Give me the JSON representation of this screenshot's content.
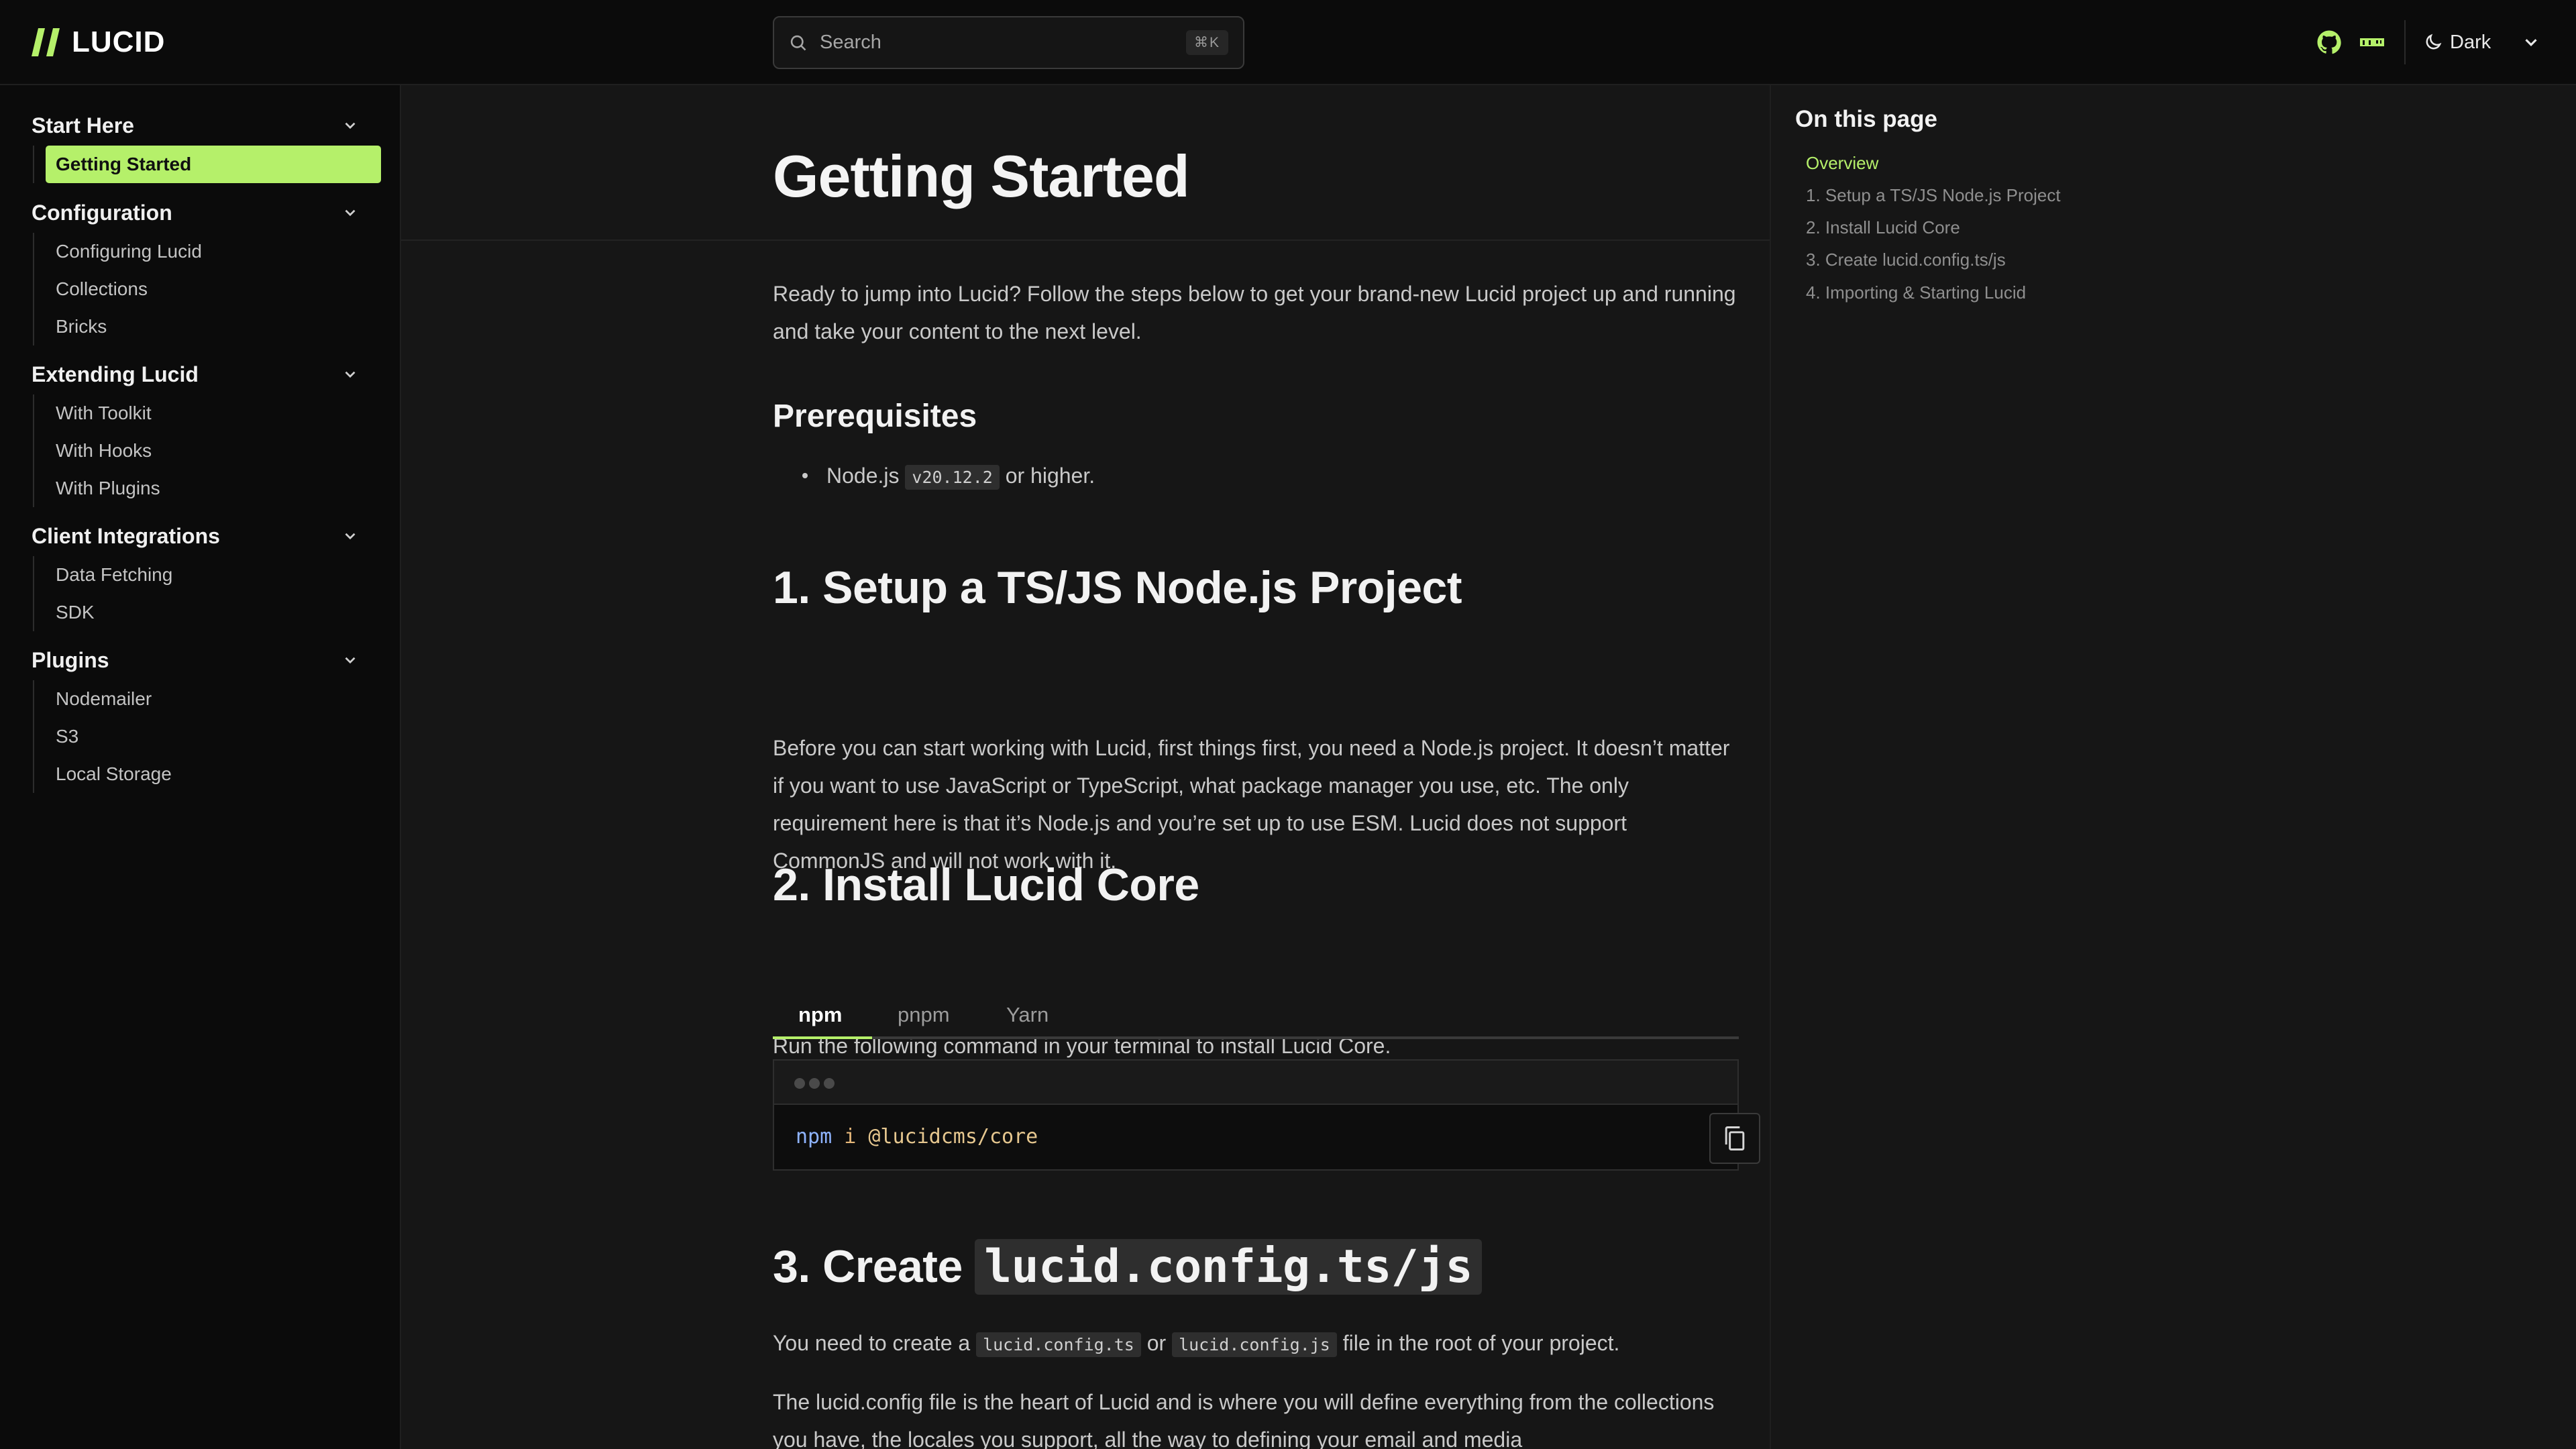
{
  "header": {
    "logo_text": "LUCID",
    "search_placeholder": "Search",
    "search_shortcut": "⌘K",
    "theme_label": "Dark",
    "icons": [
      "github-icon",
      "npm-icon",
      "moon-icon",
      "chevron-down-icon"
    ]
  },
  "sidebar": {
    "groups": [
      {
        "title": "Start Here",
        "items": [
          "Getting Started"
        ],
        "active": "Getting Started"
      },
      {
        "title": "Configuration",
        "items": [
          "Configuring Lucid",
          "Collections",
          "Bricks"
        ]
      },
      {
        "title": "Extending Lucid",
        "items": [
          "With Toolkit",
          "With Hooks",
          "With Plugins"
        ]
      },
      {
        "title": "Client Integrations",
        "items": [
          "Data Fetching",
          "SDK"
        ]
      },
      {
        "title": "Plugins",
        "items": [
          "Nodemailer",
          "S3",
          "Local Storage"
        ]
      }
    ]
  },
  "main": {
    "title": "Getting Started",
    "intro": "Ready to jump into Lucid? Follow the steps below to get your brand-new Lucid project up and running and take your content to the next level.",
    "prereq_heading": "Prerequisites",
    "prereq_item_prefix": "Node.js",
    "prereq_item_code": "v20.12.2",
    "prereq_item_suffix": "or higher.",
    "step1_heading": "1. Setup a TS/JS Node.js Project",
    "step1_body": "Before you can start working with Lucid, first things first, you need a Node.js project. It doesn’t matter if you want to use JavaScript or TypeScript, what package manager you use, etc. The only requirement here is that it’s Node.js and you’re set up to use ESM. Lucid does not support CommonJS and will not work with it.",
    "step2_heading": "2. Install Lucid Core",
    "step2_body": "Run the following command in your terminal to install Lucid Core.",
    "tabs": [
      "npm",
      "pnpm",
      "Yarn"
    ],
    "active_tab": "npm",
    "code_cmd": "npm",
    "code_arg": "i",
    "code_pkg": "@lucidcms/core",
    "step3_heading_prefix": "3. Create",
    "step3_heading_code": "lucid.config.ts/js",
    "step3_body_prefix": "You need to create a",
    "step3_body_code1": "lucid.config.ts",
    "step3_body_mid": "or",
    "step3_body_code2": "lucid.config.js",
    "step3_body_suffix": "file in the root of your project.",
    "step3_body2": "The lucid.config file is the heart of Lucid and is where you will define everything from the collections you have, the locales you support, all the way to defining your email and media"
  },
  "toc": {
    "title": "On this page",
    "items": [
      "Overview",
      "1. Setup a TS/JS Node.js Project",
      "2. Install Lucid Core",
      "3. Create lucid.config.ts/js",
      "4. Importing & Starting Lucid"
    ],
    "active": "Overview"
  },
  "colors": {
    "accent": "#b5f06a",
    "background": "#161616",
    "sidebar": "#0b0b0b"
  }
}
